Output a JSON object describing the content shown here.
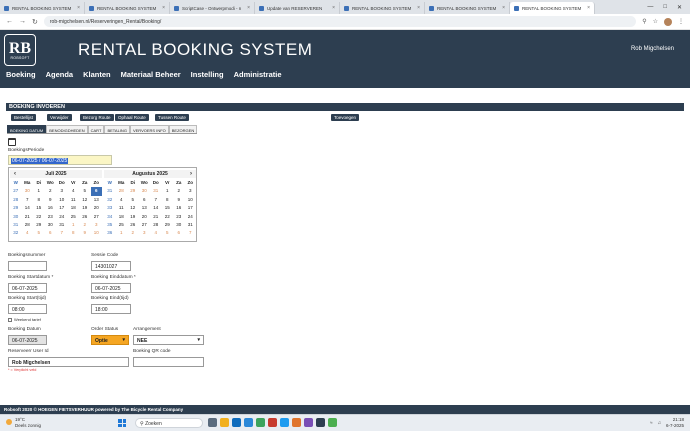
{
  "browser": {
    "tabs": [
      {
        "label": "RENTAL BOOKING SYSTEM",
        "active": false
      },
      {
        "label": "RENTAL BOOKING SYSTEM",
        "active": false
      },
      {
        "label": "ScriptCase - Ontwerpmodi - n",
        "active": false
      },
      {
        "label": "Update van RESERVEREN",
        "active": false
      },
      {
        "label": "RENTAL BOOKING SYSTEM",
        "active": false
      },
      {
        "label": "RENTAL BOOKING SYSTEM",
        "active": false
      },
      {
        "label": "RENTAL BOOKING SYSTEM",
        "active": true
      }
    ],
    "url": "rob-migchelsen.nl/Reserveringen_Rental/Booking/"
  },
  "header": {
    "logo_mark": "RB",
    "logo_sub": "ROBSOFT",
    "title": "RENTAL BOOKING SYSTEM",
    "user": "Rob Migchelsen",
    "nav": [
      "Boeking",
      "Agenda",
      "Klanten",
      "Materiaal Beheer",
      "Instelling",
      "Administratie"
    ]
  },
  "section_title": "BOEKING INVOEREN",
  "toolbar": {
    "bestellijst": "Bestellijst",
    "verwijder": "Verwijder",
    "bezorg_route": "Bezorg Route",
    "ophaal_route": "Ophaal Route",
    "tussen_route": "Tussen Route",
    "toevoegen": "Toevoegen"
  },
  "subtabs": [
    "BOEKING DATUM",
    "BENODIGDHEDEN",
    "CART",
    "BETALING",
    "VERVOERS INFO",
    "BEZORGEN"
  ],
  "form": {
    "periode_label": "BoekingsPeriode",
    "periode_value": "06-07-2025 / 06-07-2025",
    "boekingsnummer_label": "Boekingsnummer",
    "boekingsnummer_value": "",
    "sessie_label": "Sessie Code",
    "sessie_value": "14301027",
    "startdatum_label": "Boeking Startdatum *",
    "startdatum_value": "06-07-2025",
    "einddatum_label": "Boeking Einddatum *",
    "einddatum_value": "06-07-2025",
    "starttijd_label": "Boeking Start(tijd)",
    "starttijd_value": "08:00",
    "eindtijd_label": "Boeking Eind(tijd)",
    "eindtijd_value": "18:00",
    "weekend_label": "Weekend tarief",
    "boeking_datum_label": "Boeking Datum",
    "boeking_datum_value": "06-07-2025",
    "order_status_label": "Order Status",
    "order_status_value": "Optie",
    "arrangement_label": "Arrangement",
    "arrangement_value": "NEE",
    "reserveerder_label": "Reserveerr User Id",
    "reserveerder_value": "Rob Migchelsen",
    "qr_label": "Boeking QR code",
    "required_note": "* = Verplicht veld"
  },
  "calendar": {
    "months": [
      {
        "title": "Juli 2025",
        "headers": [
          "W",
          "Ma",
          "Di",
          "Wo",
          "Do",
          "Vr",
          "Za",
          "Zo"
        ],
        "rows": [
          {
            "wk": "27",
            "days": [
              "30",
              "1",
              "2",
              "3",
              "4",
              "5",
              "6"
            ],
            "other": [
              0
            ],
            "today": 6
          },
          {
            "wk": "28",
            "days": [
              "7",
              "8",
              "9",
              "10",
              "11",
              "12",
              "13"
            ],
            "other": [],
            "today": -1
          },
          {
            "wk": "29",
            "days": [
              "14",
              "15",
              "16",
              "17",
              "18",
              "19",
              "20"
            ],
            "other": [],
            "today": -1
          },
          {
            "wk": "30",
            "days": [
              "21",
              "22",
              "23",
              "24",
              "25",
              "26",
              "27"
            ],
            "other": [],
            "today": -1
          },
          {
            "wk": "31",
            "days": [
              "28",
              "29",
              "30",
              "31",
              "1",
              "2",
              "3"
            ],
            "other": [
              4,
              5,
              6
            ],
            "today": -1
          },
          {
            "wk": "32",
            "days": [
              "4",
              "5",
              "6",
              "7",
              "8",
              "9",
              "10"
            ],
            "other": [
              0,
              1,
              2,
              3,
              4,
              5,
              6
            ],
            "today": -1
          }
        ]
      },
      {
        "title": "Augustus 2025",
        "headers": [
          "W",
          "Ma",
          "Di",
          "Wo",
          "Do",
          "Vr",
          "Za",
          "Zo"
        ],
        "rows": [
          {
            "wk": "31",
            "days": [
              "28",
              "29",
              "30",
              "31",
              "1",
              "2",
              "3"
            ],
            "other": [
              0,
              1,
              2,
              3
            ],
            "today": -1
          },
          {
            "wk": "32",
            "days": [
              "4",
              "5",
              "6",
              "7",
              "8",
              "9",
              "10"
            ],
            "other": [],
            "today": -1
          },
          {
            "wk": "33",
            "days": [
              "11",
              "12",
              "13",
              "14",
              "15",
              "16",
              "17"
            ],
            "other": [],
            "today": -1
          },
          {
            "wk": "34",
            "days": [
              "18",
              "19",
              "20",
              "21",
              "22",
              "23",
              "24"
            ],
            "other": [],
            "today": -1
          },
          {
            "wk": "35",
            "days": [
              "25",
              "26",
              "27",
              "28",
              "29",
              "30",
              "31"
            ],
            "other": [],
            "today": -1
          },
          {
            "wk": "36",
            "days": [
              "1",
              "2",
              "3",
              "4",
              "5",
              "6",
              "7"
            ],
            "other": [
              0,
              1,
              2,
              3,
              4,
              5,
              6
            ],
            "today": -1
          }
        ]
      }
    ]
  },
  "footer": "Robsoft 2020 © HOEGEN FIETSVERHUUR powered by The Bicycle Rental Company",
  "taskbar": {
    "weather_temp": "19°C",
    "weather_desc": "Deels zonnig",
    "search": "Zoeken",
    "time": "21:18",
    "date": "6-7-2025"
  }
}
